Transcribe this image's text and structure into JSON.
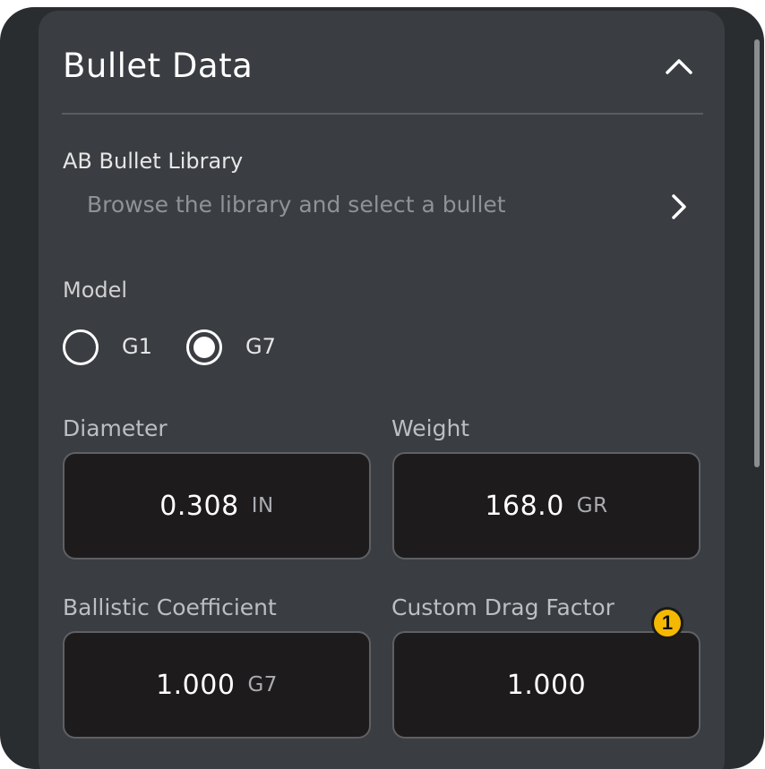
{
  "section": {
    "title": "Bullet Data"
  },
  "library": {
    "title": "AB Bullet Library",
    "subtitle": "Browse the library and select a bullet"
  },
  "model": {
    "label": "Model",
    "options": [
      {
        "label": "G1",
        "selected": false
      },
      {
        "label": "G7",
        "selected": true
      }
    ]
  },
  "fields": {
    "diameter": {
      "label": "Diameter",
      "value": "0.308",
      "unit": "IN"
    },
    "weight": {
      "label": "Weight",
      "value": "168.0",
      "unit": "GR"
    },
    "ballistic_coefficient": {
      "label": "Ballistic Coefficient",
      "value": "1.000",
      "unit": "G7"
    },
    "custom_drag_factor": {
      "label": "Custom Drag Factor",
      "value": "1.000"
    }
  },
  "annotation": {
    "badge_number": "1"
  },
  "colors": {
    "card": "#3a3d41",
    "background": "#2a2d30",
    "field": "#1e1b1c",
    "badge": "#f5b800"
  }
}
